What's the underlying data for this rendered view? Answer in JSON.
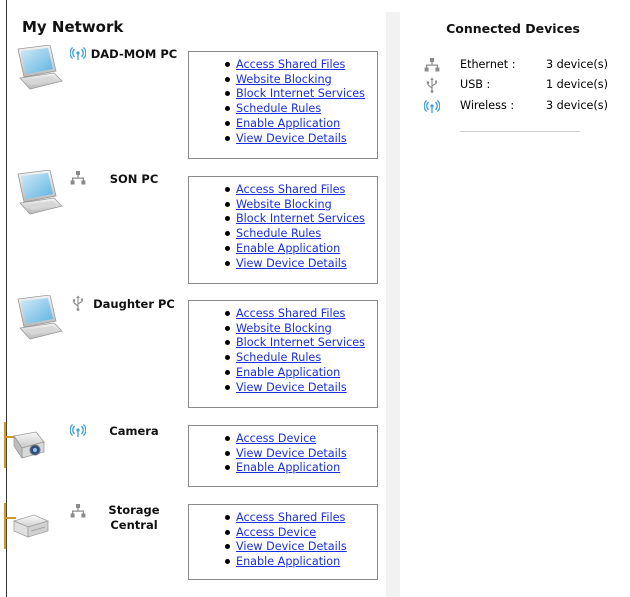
{
  "page": {
    "title": "My Network"
  },
  "devices": [
    {
      "name": "DAD-MOM PC",
      "type": "pc",
      "connection": "wireless",
      "actions": [
        "Access Shared Files",
        "Website Blocking",
        "Block Internet Services",
        "Schedule Rules",
        "Enable Application",
        "View Device Details"
      ]
    },
    {
      "name": "SON PC",
      "type": "pc",
      "connection": "ethernet",
      "actions": [
        "Access Shared Files",
        "Website Blocking",
        "Block Internet Services",
        "Schedule Rules",
        "Enable Application",
        "View Device Details"
      ]
    },
    {
      "name": "Daughter PC",
      "type": "pc",
      "connection": "usb",
      "actions": [
        "Access Shared Files",
        "Website Blocking",
        "Block Internet Services",
        "Schedule Rules",
        "Enable Application",
        "View Device Details"
      ]
    },
    {
      "name": "Camera",
      "type": "camera",
      "connection": "wireless",
      "actions": [
        "Access Device",
        "View Device Details",
        "Enable Application"
      ]
    },
    {
      "name": "Storage Central",
      "type": "storage",
      "connection": "ethernet",
      "actions": [
        "Access Shared Files",
        "Access Device",
        "View Device Details",
        "Enable Application"
      ]
    }
  ],
  "connected_devices": {
    "title": "Connected Devices",
    "rows": [
      {
        "icon": "ethernet-icon",
        "label": "Ethernet :",
        "count": "3 device(s)"
      },
      {
        "icon": "usb-icon",
        "label": "USB :",
        "count": "1 device(s)"
      },
      {
        "icon": "wireless-icon",
        "label": "Wireless :",
        "count": "3 device(s)"
      }
    ]
  },
  "colors": {
    "link": "#1a2ee0",
    "wireless": "#3aa0e0",
    "border": "#888888"
  }
}
